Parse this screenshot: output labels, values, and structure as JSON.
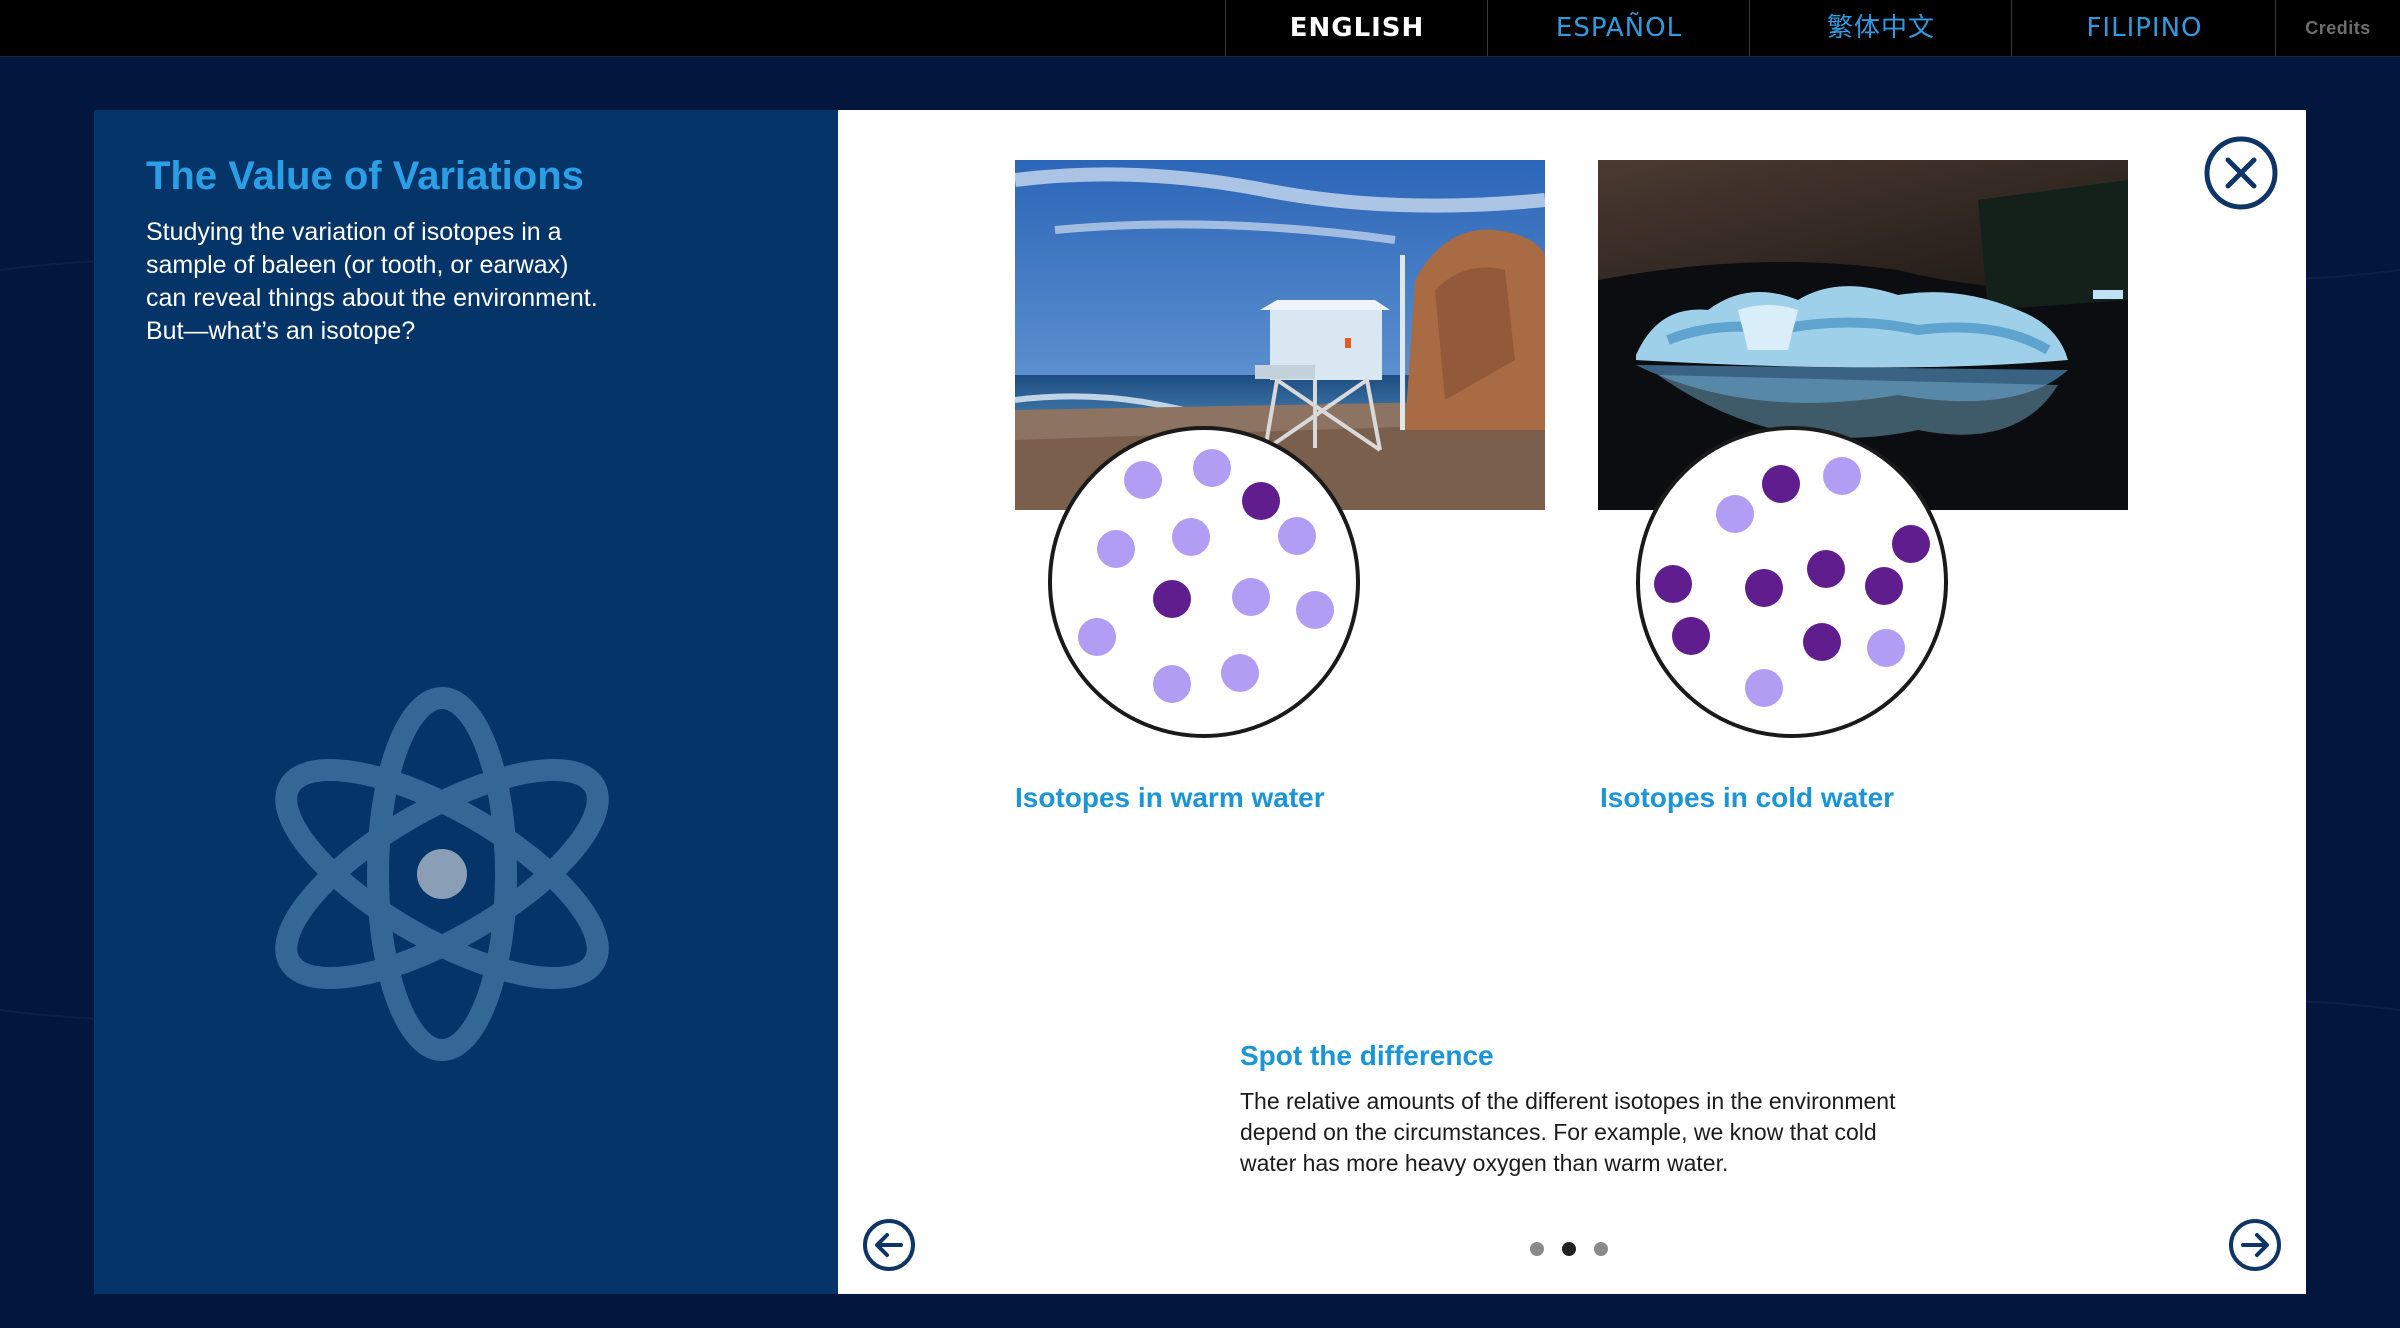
{
  "languages": [
    {
      "label": "ENGLISH",
      "active": true
    },
    {
      "label": "ESPAÑOL",
      "active": false
    },
    {
      "label": "繁体中文",
      "active": false
    },
    {
      "label": "FILIPINO",
      "active": false
    }
  ],
  "credits_label": "Credits",
  "left_panel": {
    "title": "The Value of Variations",
    "body": "Studying the variation of isotopes in a sample of baleen (or tooth, or earwax) can reveal things about the environment. But—what’s an isotope?",
    "icon": "atom-icon"
  },
  "slide": {
    "warm_caption": "Isotopes in warm water",
    "cold_caption": "Isotopes in cold water",
    "warm_icon": "lifeguard-tower-beach-photo",
    "cold_icon": "iceberg-photo",
    "diff_title": "Spot the difference",
    "diff_body": "The relative amounts of the different isotopes in the environment depend on the circumstances. For example, we know that cold water has more heavy oxygen than warm water."
  },
  "pagination": {
    "total": 3,
    "current": 2
  },
  "colors": {
    "background": "#03163d",
    "panel_blue": "#053468",
    "accent_blue": "#1b95d6",
    "light_isotope": "#b19df4",
    "heavy_isotope": "#5f1d8e",
    "icon_navy": "#0e3566"
  }
}
